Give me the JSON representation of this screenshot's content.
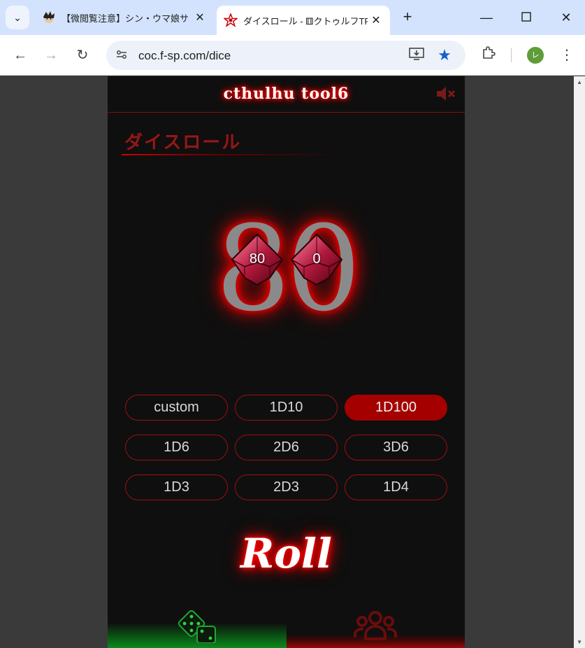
{
  "browser": {
    "tabs": [
      {
        "title": "【微閲覧注意】シン・ウマ娘サ",
        "active": false
      },
      {
        "title": "ダイスロール - ⚅クトゥルフTRPG",
        "active": true
      }
    ],
    "url": "coc.f-sp.com/dice",
    "profile_initial": "レ"
  },
  "app": {
    "logo_text": "cthulhu tool6",
    "page_title": "ダイスロール",
    "result": "80",
    "dice": [
      {
        "label": "80"
      },
      {
        "label": "0"
      }
    ],
    "buttons": [
      {
        "label": "custom",
        "selected": false
      },
      {
        "label": "1D10",
        "selected": false
      },
      {
        "label": "1D100",
        "selected": true
      },
      {
        "label": "1D6",
        "selected": false
      },
      {
        "label": "2D6",
        "selected": false
      },
      {
        "label": "3D6",
        "selected": false
      },
      {
        "label": "1D3",
        "selected": false
      },
      {
        "label": "2D3",
        "selected": false
      },
      {
        "label": "1D4",
        "selected": false
      }
    ],
    "roll_label": "Roll",
    "bottom_nav": [
      {
        "name": "dice",
        "active": true
      },
      {
        "name": "group",
        "active": false
      }
    ]
  },
  "colors": {
    "accent_red": "#a50000",
    "glow_red": "#ff0000",
    "active_green": "#0c8a1c",
    "background": "#0f0f0f"
  }
}
